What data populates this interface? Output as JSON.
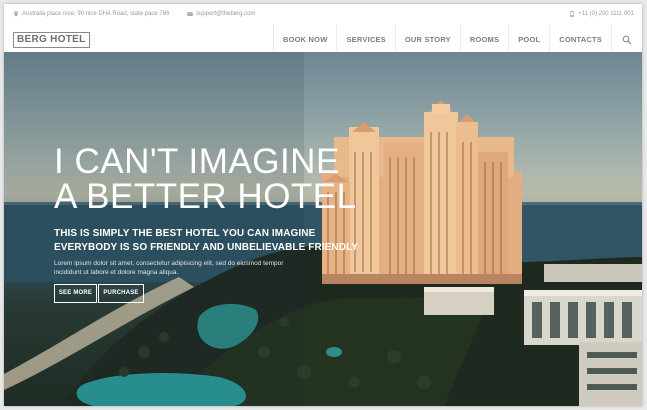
{
  "topbar": {
    "address": "Australia place nice, 90 nice DHA Road, state pace 786",
    "email": "support@theberg.com",
    "phone": "+11 (0) 200 1111 001"
  },
  "nav": {
    "logo": "BERG HOTEL",
    "items": [
      {
        "label": "BOOK NOW"
      },
      {
        "label": "SERVICES"
      },
      {
        "label": "OUR STORY"
      },
      {
        "label": "ROOMS"
      },
      {
        "label": "POOL"
      },
      {
        "label": "CONTACTS"
      }
    ]
  },
  "hero": {
    "title_line1": "I CAN'T IMAGINE",
    "title_line2": "A BETTER HOTEL",
    "subtitle_line1": "THIS IS SIMPLY THE BEST HOTEL YOU CAN IMAGINE",
    "subtitle_line2": "EVERYBODY IS SO FRIENDLY AND UNBELIEVABLE FRIENDLY",
    "body": "Lorem ipsum dolor sit amet, consectetur adipisicing elit, sed do eiusmod tempor incididunt ut labore et dolore magna aliqua.",
    "buttons": [
      {
        "label": "SEE MORE"
      },
      {
        "label": "PURCHASE"
      }
    ]
  },
  "icons": [
    "map-pin-icon",
    "envelope-icon",
    "phone-icon",
    "search-icon"
  ],
  "colors": {
    "nav_text": "#7d7d7d",
    "hero_text": "#ffffff",
    "building": "#e9b98b"
  }
}
